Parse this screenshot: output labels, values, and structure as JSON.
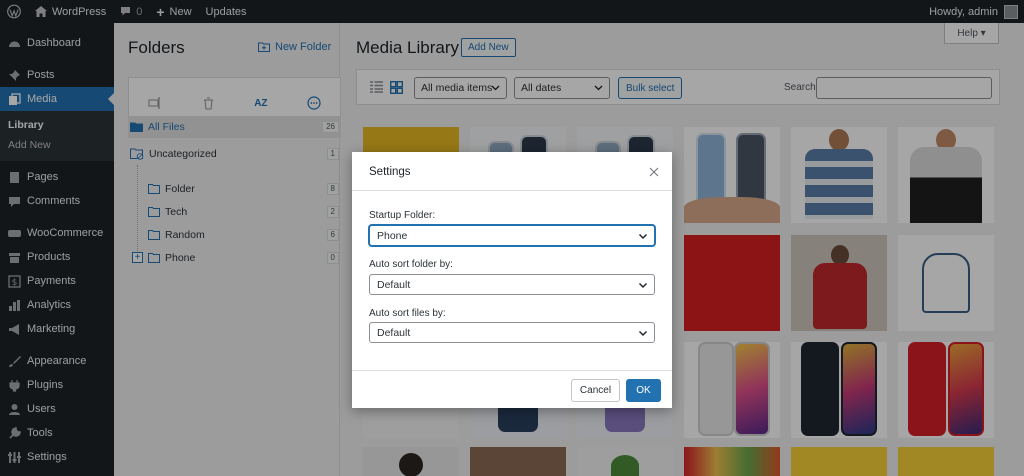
{
  "adminbar": {
    "site_name": "WordPress",
    "comments_count": "0",
    "new_label": "New",
    "updates_label": "Updates",
    "howdy": "Howdy, admin"
  },
  "sidebar": {
    "items": [
      {
        "label": "Dashboard",
        "icon": "dashboard-icon"
      },
      {
        "label": "Posts",
        "icon": "pin-icon"
      },
      {
        "label": "Media",
        "icon": "media-icon"
      },
      {
        "label": "Pages",
        "icon": "page-icon"
      },
      {
        "label": "Comments",
        "icon": "comment-icon"
      },
      {
        "label": "WooCommerce",
        "icon": "woo-icon"
      },
      {
        "label": "Products",
        "icon": "archive-icon"
      },
      {
        "label": "Payments",
        "icon": "dollar-icon"
      },
      {
        "label": "Analytics",
        "icon": "chart-icon"
      },
      {
        "label": "Marketing",
        "icon": "megaphone-icon"
      },
      {
        "label": "Appearance",
        "icon": "brush-icon"
      },
      {
        "label": "Plugins",
        "icon": "plug-icon"
      },
      {
        "label": "Users",
        "icon": "user-icon"
      },
      {
        "label": "Tools",
        "icon": "wrench-icon"
      },
      {
        "label": "Settings",
        "icon": "settings-icon"
      }
    ],
    "submenu": [
      "Library",
      "Add New"
    ]
  },
  "folders": {
    "title": "Folders",
    "new_folder": "New Folder",
    "all_files": {
      "label": "All Files",
      "count": "26"
    },
    "uncategorized": {
      "label": "Uncategorized",
      "count": "1"
    },
    "children": [
      {
        "label": "Folder",
        "count": "8"
      },
      {
        "label": "Tech",
        "count": "2"
      },
      {
        "label": "Random",
        "count": "6"
      },
      {
        "label": "Phone",
        "count": "0"
      }
    ],
    "sort_icon_text": "AZ"
  },
  "main": {
    "title": "Media Library",
    "add_new": "Add New",
    "help": "Help ▾",
    "filter_type": "All media items",
    "filter_dates": "All dates",
    "bulk_select": "Bulk select",
    "search_label": "Search"
  },
  "modal": {
    "title": "Settings",
    "startup_label": "Startup Folder:",
    "startup_value": "Phone",
    "sort_folder_label": "Auto sort folder by:",
    "sort_folder_value": "Default",
    "sort_files_label": "Auto sort files by:",
    "sort_files_value": "Default",
    "cancel": "Cancel",
    "ok": "OK"
  },
  "colors": {
    "admin_dark": "#1d2327",
    "accent": "#2271b1"
  }
}
